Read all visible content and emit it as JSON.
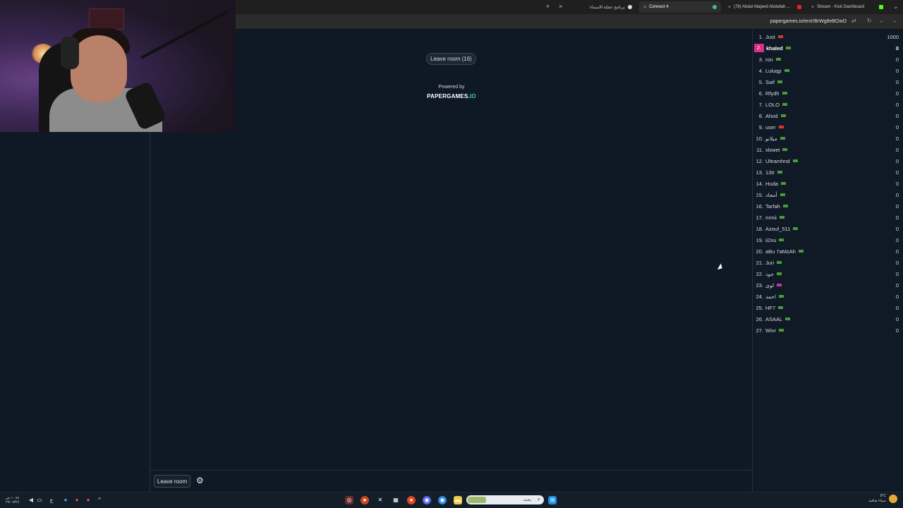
{
  "browser": {
    "tabs": [
      {
        "label": "برنامج عجلة الاسماء",
        "active": false
      },
      {
        "label": "Connect 4",
        "active": true
      },
      {
        "label": "(78) Abdul Majeed Abdullah ...",
        "active": false
      },
      {
        "label": "Stream - Kick Dashboard",
        "active": false
      }
    ],
    "new_tab": "+",
    "close": "×",
    "url": "papergames.io/en/r/BrWg8eBOwO"
  },
  "game": {
    "leave_room_pill": "Leave room  (16)",
    "powered_by": "Powered by",
    "brand_main": "PAPERGAMES.",
    "brand_io": "IO",
    "leave_room_button": "Leave room"
  },
  "leaderboard": {
    "rows": [
      {
        "rank": "1.",
        "name": "Just",
        "score": "1000",
        "flag": "#d33"
      },
      {
        "rank": "2.",
        "name": "khaled",
        "score": "0",
        "flag": "#4a9a3a",
        "current": true
      },
      {
        "rank": "3.",
        "name": "ron",
        "score": "0",
        "flag": "#4a9a3a"
      },
      {
        "rank": "4.",
        "name": "Luluqp",
        "score": "0",
        "flag": "#4a9a3a"
      },
      {
        "rank": "5.",
        "name": "Saif",
        "score": "0",
        "flag": "#4a9a3a"
      },
      {
        "rank": "6.",
        "name": "Rfydh",
        "score": "0",
        "flag": "#4a9a3a"
      },
      {
        "rank": "7.",
        "name": "LOLO",
        "score": "0",
        "flag": "#4a9a3a"
      },
      {
        "rank": "8.",
        "name": "Ahod",
        "score": "0",
        "flag": "#4a9a3a"
      },
      {
        "rank": "9.",
        "name": "user",
        "score": "0",
        "flag": "#d33"
      },
      {
        "rank": "10.",
        "name": "ميلانو",
        "score": "0",
        "flag": "#4a9a3a"
      },
      {
        "rank": "11.",
        "name": "xlxwei",
        "score": "0",
        "flag": "#4a9a3a"
      },
      {
        "rank": "12.",
        "name": "Ultramhnd",
        "score": "0",
        "flag": "#4a9a3a"
      },
      {
        "rank": "13.",
        "name": "13tr",
        "score": "0",
        "flag": "#4a9a3a"
      },
      {
        "rank": "14.",
        "name": "Huda",
        "score": "0",
        "flag": "#4a9a3a"
      },
      {
        "rank": "15.",
        "name": "أمجاد",
        "score": "0",
        "flag": "#4a9a3a"
      },
      {
        "rank": "16.",
        "name": "Tarfah",
        "score": "0",
        "flag": "#4a9a3a"
      },
      {
        "rank": "17.",
        "name": "mmii",
        "score": "0",
        "flag": "#4a9a3a"
      },
      {
        "rank": "18.",
        "name": "Azouf_511",
        "score": "0",
        "flag": "#4a9a3a"
      },
      {
        "rank": "19.",
        "name": "ii2xu",
        "score": "0",
        "flag": "#4a9a3a"
      },
      {
        "rank": "20.",
        "name": "aBu 7aMzAh",
        "score": "0",
        "flag": "#4a9a3a"
      },
      {
        "rank": "21.",
        "name": "Juri",
        "score": "0",
        "flag": "#4a9a3a"
      },
      {
        "rank": "22.",
        "name": "جود",
        "score": "0",
        "flag": "#4a9a3a"
      },
      {
        "rank": "23.",
        "name": "لوى",
        "score": "0",
        "flag": "#c33a9a"
      },
      {
        "rank": "24.",
        "name": "احمد",
        "score": "0",
        "flag": "#4a9a3a"
      },
      {
        "rank": "25.",
        "name": "HF7",
        "score": "0",
        "flag": "#4a9a3a"
      },
      {
        "rank": "26.",
        "name": "ASAAL",
        "score": "0",
        "flag": "#4a9a3a"
      },
      {
        "rank": "27.",
        "name": "Wivr",
        "score": "0",
        "flag": "#4a9a3a"
      }
    ]
  },
  "taskbar": {
    "clock_time": "١٠:٤٤ ص",
    "clock_date": "٢٧/٠٧/٢٥",
    "lang": "ع",
    "search_placeholder": "بحث",
    "weather_temp": "9°C",
    "weather_desc": "سماء صافية"
  },
  "colors": {
    "background": "#0f1925",
    "highlight_rank": "#d92e8a",
    "brand_io": "#2ecbd0"
  }
}
